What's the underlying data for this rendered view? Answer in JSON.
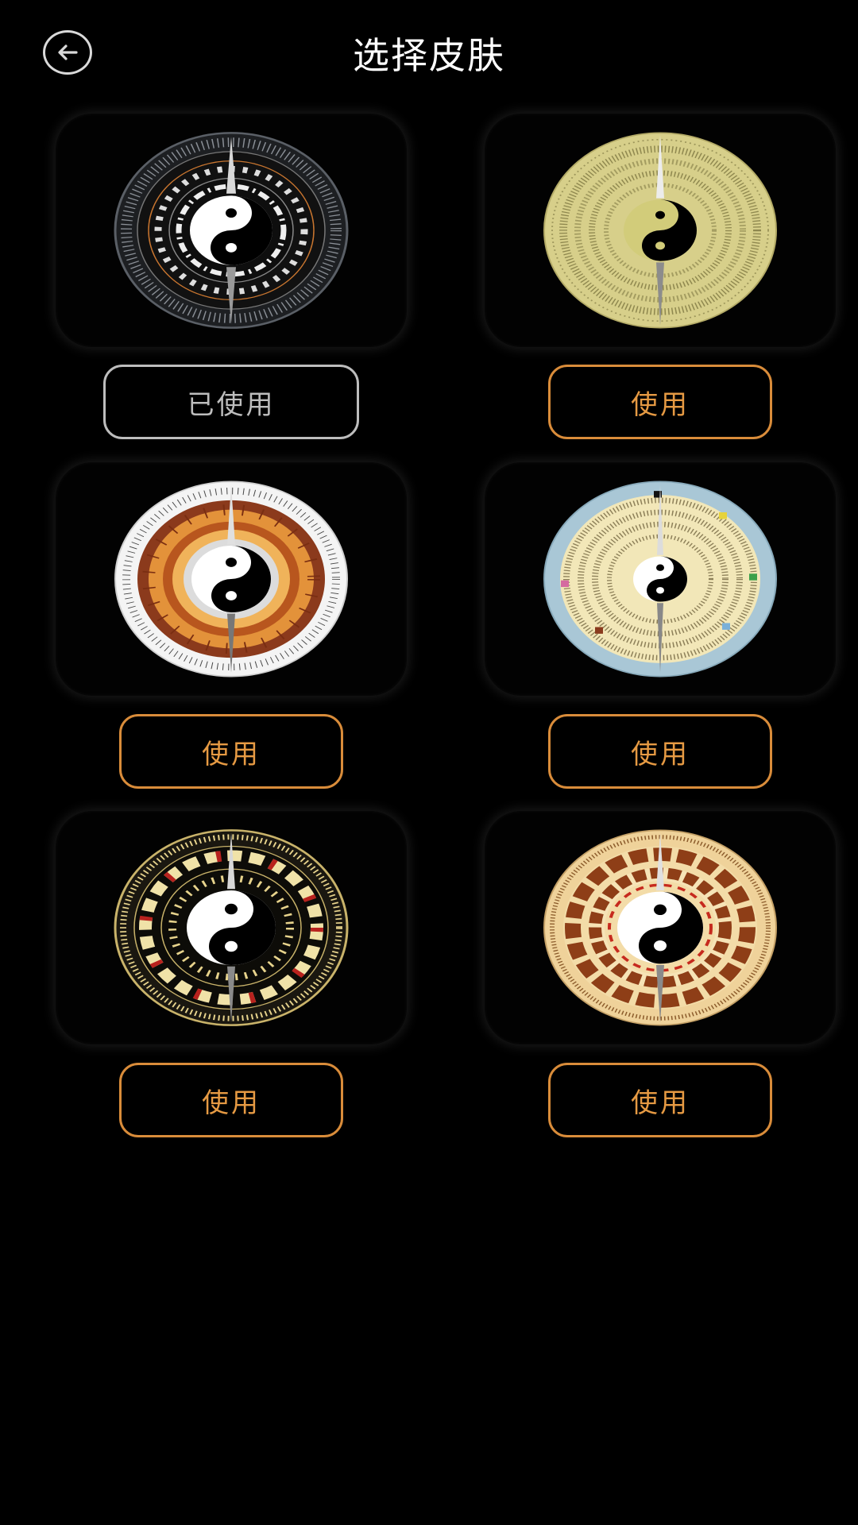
{
  "header": {
    "title": "选择皮肤",
    "back_icon": "arrow-left-icon"
  },
  "colors": {
    "accent": "#e69a43",
    "used_border": "#bdbdbd",
    "background": "#000000"
  },
  "skins": [
    {
      "name": "black-steel",
      "button_label": "已使用",
      "state": "used"
    },
    {
      "name": "olive-gold",
      "button_label": "使用",
      "state": "available"
    },
    {
      "name": "white-orange",
      "button_label": "使用",
      "state": "available"
    },
    {
      "name": "blue-cream",
      "button_label": "使用",
      "state": "available"
    },
    {
      "name": "black-gold",
      "button_label": "使用",
      "state": "available"
    },
    {
      "name": "amber-brown",
      "button_label": "使用",
      "state": "available"
    }
  ]
}
